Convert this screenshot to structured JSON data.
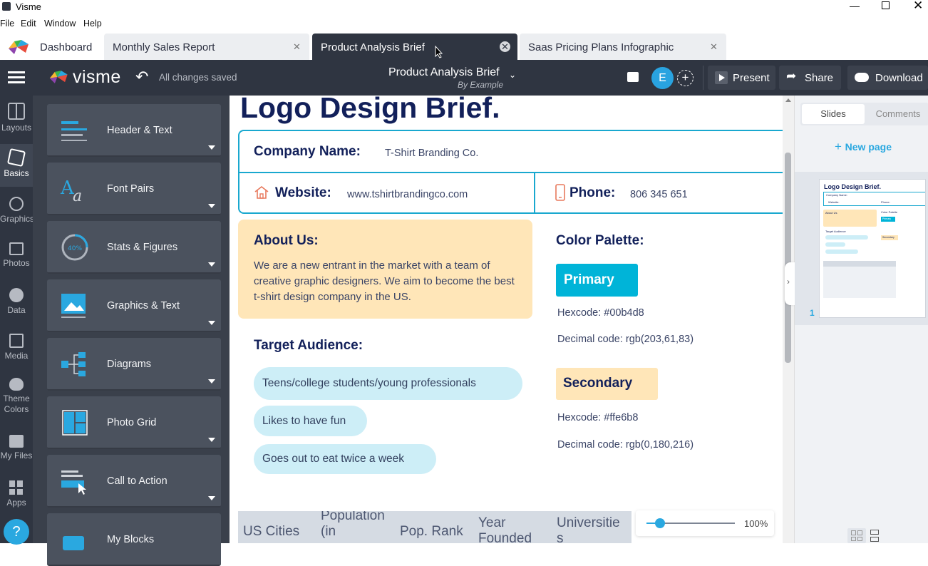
{
  "window": {
    "title": "Visme"
  },
  "menu": [
    "File",
    "Edit",
    "Window",
    "Help"
  ],
  "tabs": {
    "dashboard": "Dashboard",
    "items": [
      {
        "label": "Monthly Sales Report"
      },
      {
        "label": "Product Analysis Brief"
      },
      {
        "label": "Saas Pricing Plans Infographic"
      }
    ]
  },
  "appbar": {
    "logo": "visme",
    "save_status": "All changes saved",
    "doc_title": "Product Analysis Brief",
    "doc_subtitle": "By Example",
    "avatar_initial": "E",
    "present": "Present",
    "share": "Share",
    "download": "Download"
  },
  "rail": [
    {
      "label": "Layouts",
      "icon": "layouts-icon"
    },
    {
      "label": "Basics",
      "icon": "basics-icon"
    },
    {
      "label": "Graphics",
      "icon": "graphics-icon"
    },
    {
      "label": "Photos",
      "icon": "photos-icon"
    },
    {
      "label": "Data",
      "icon": "data-icon"
    },
    {
      "label": "Media",
      "icon": "media-icon"
    },
    {
      "label": "Theme Colors",
      "icon": "palette-icon"
    },
    {
      "label": "My Files",
      "icon": "upload-icon"
    },
    {
      "label": "Apps",
      "icon": "apps-icon"
    }
  ],
  "help": "?",
  "panel": [
    {
      "label": "Header & Text"
    },
    {
      "label": "Font Pairs"
    },
    {
      "label": "Stats & Figures",
      "badge": "40%"
    },
    {
      "label": "Graphics & Text"
    },
    {
      "label": "Diagrams"
    },
    {
      "label": "Photo Grid"
    },
    {
      "label": "Call to Action"
    },
    {
      "label": "My Blocks"
    }
  ],
  "doc": {
    "title": "Logo Design Brief.",
    "company_label": "Company Name:",
    "company_value": "T-Shirt Branding Co.",
    "website_label": "Website:",
    "website_value": "www.tshirtbrandingco.com",
    "phone_label": "Phone:",
    "phone_value": "806 345 651",
    "about_title": "About Us:",
    "about_text": "We are a new entrant in the market with a team of creative graphic designers. We aim to become the best t-shirt design company in the US.",
    "audience_title": "Target Audience:",
    "audience": [
      "Teens/college students/young professionals",
      "Likes to have fun",
      "Goes out to eat twice a week"
    ],
    "palette_title": "Color Palette:",
    "primary": {
      "label": "Primary",
      "hex": "Hexcode: #00b4d8",
      "decimal": "Decimal code: rgb(203,61,83)",
      "color": "#00b4d8"
    },
    "secondary": {
      "label": "Secondary",
      "hex": "Hexcode: #ffe6b8",
      "decimal": "Decimal code: rgb(0,180,216)",
      "color": "#ffe6b8"
    },
    "table_headers": [
      "US Cities",
      "Population (in",
      "Pop. Rank",
      "Year Founded",
      "Universitie s"
    ]
  },
  "zoom": "100%",
  "zoom_level": 0.15,
  "right": {
    "tab_slides": "Slides",
    "tab_comments": "Comments",
    "new_page": "New page",
    "page_number": "1",
    "thumb_title": "Logo Design Brief.",
    "thumb_company": "Company Name:",
    "thumb_website": "Website:",
    "thumb_phone": "Phone:",
    "thumb_about": "About Us",
    "thumb_audience": "Target Audience",
    "thumb_palette": "Color Palette",
    "thumb_primary": "Primary",
    "thumb_secondary": "Secondary"
  },
  "colors": {
    "appbar": "#2f3541",
    "navy": "#12205a",
    "accent": "#00b4d8",
    "about_bg": "#ffe6b8",
    "pill_bg": "#cdeef7"
  }
}
